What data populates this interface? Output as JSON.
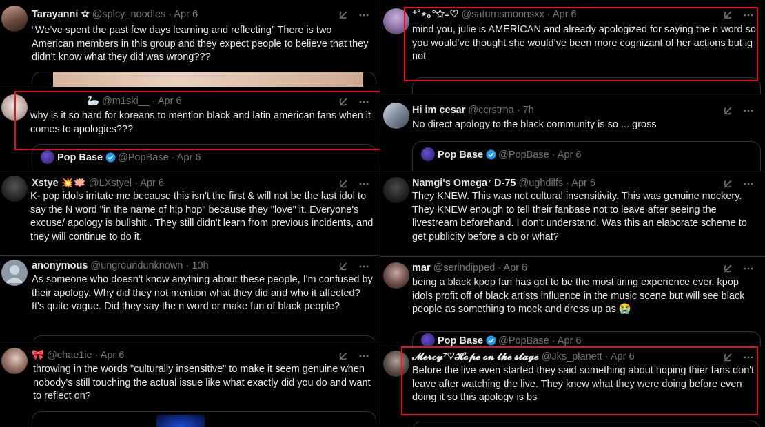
{
  "quote_source": {
    "name": "Pop Base",
    "handle": "@PopBase",
    "date": "Apr 6"
  },
  "left": [
    {
      "id": "t1",
      "name": "Tarayanni ✫",
      "handle": "@splcy_noodles",
      "date": "· Apr 6",
      "body": "“We’ve spent the past few days learning and reflecting” There is two American members in this group and they expect people to believe that they didn’t know what they did was wrong???"
    },
    {
      "id": "t2",
      "name": "",
      "handle": "🦢 @m1ski__",
      "date": "· Apr 6",
      "body": "why is it so hard for koreans to mention black and latin american fans when it comes to apologies???"
    },
    {
      "id": "t3",
      "name": "Xstye",
      "name_emoji": "💥🪷",
      "handle": "@LXstyel",
      "date": "· Apr 6",
      "body": "K- pop idols irritate me because this isn't the first & will not be the last idol to say the N word \"in the name of hip hop\" because they \"love\" it. Everyone's excuse/ apology is bullshit . They still didn't  learn from previous incidents, and they will continue to do it."
    },
    {
      "id": "t4",
      "name": "anonymous",
      "handle": "@ungroundunknown",
      "date": "· 10h",
      "body": "As someone who doesn't know anything about these people, I'm confused by their apology. Why did they not mention what they did and who it affected? It's quite vague. Did they say the n word or make fun of black people?"
    },
    {
      "id": "t5",
      "name": "🎀",
      "handle": "@chae1ie",
      "date": "· Apr 6",
      "body": "throwing in the words \"culturally insensitive\" to make it seem genuine when nobody's still touching the actual issue like what exactly did you do and want to reflect on?"
    }
  ],
  "right": [
    {
      "id": "r1",
      "name": "⁺˚⋆｡°✩₊♡",
      "handle": "@saturnsmoonsxx",
      "date": "· Apr 6",
      "body": "mind you, julie is AMERICAN and already apologized for saying the n word so you would’ve thought she would’ve been more cognizant of her actions but ig not"
    },
    {
      "id": "r2",
      "name": "Hi im cesar",
      "handle": "@ccrstrna",
      "date": "· 7h",
      "body": "No direct apology to the black community is so ... gross"
    },
    {
      "id": "r3",
      "name": "Namgi's Omega⁷ D-75",
      "handle": "@ughdilfs",
      "date": "· Apr 6",
      "body": "They KNEW. This was not cultural insensitivity. This was genuine mockery. They KNEW enough to tell their fanbase not to leave after seeing the livestream beforehand. I don't understand. Was this an elaborate scheme to get publicity before a cb or what?"
    },
    {
      "id": "r4",
      "name": "mar",
      "handle": "@serindipped",
      "date": "· Apr 6",
      "body": "being a black kpop fan has got to be the most tiring experience ever. kpop idols profit off of black artists influence in the music scene but will see black people as something to mock and dress up as 😭"
    },
    {
      "id": "r5",
      "name": "𝓜𝓮𝓻𝓬𝔂⁷♡𝓗𝓸𝓹𝓮 𝓸𝓷 𝓽𝓱𝓮 𝓼𝓽𝓪𝓰𝓮",
      "handle": "@Jks_planett",
      "date": "· Apr 6",
      "body": "Before the live even started they said something about hoping thier fans don't leave after watching the live. They knew what they were doing before even doing it so this apology is bs"
    }
  ],
  "icons": [
    "grok-icon",
    "more-icon",
    "verified-icon"
  ],
  "colors": {
    "background": "#000000",
    "text": "#e7e9ea",
    "muted": "#71767b",
    "border": "#2f3336",
    "highlight": "#e0141e",
    "verified": "#1d9bf0"
  }
}
